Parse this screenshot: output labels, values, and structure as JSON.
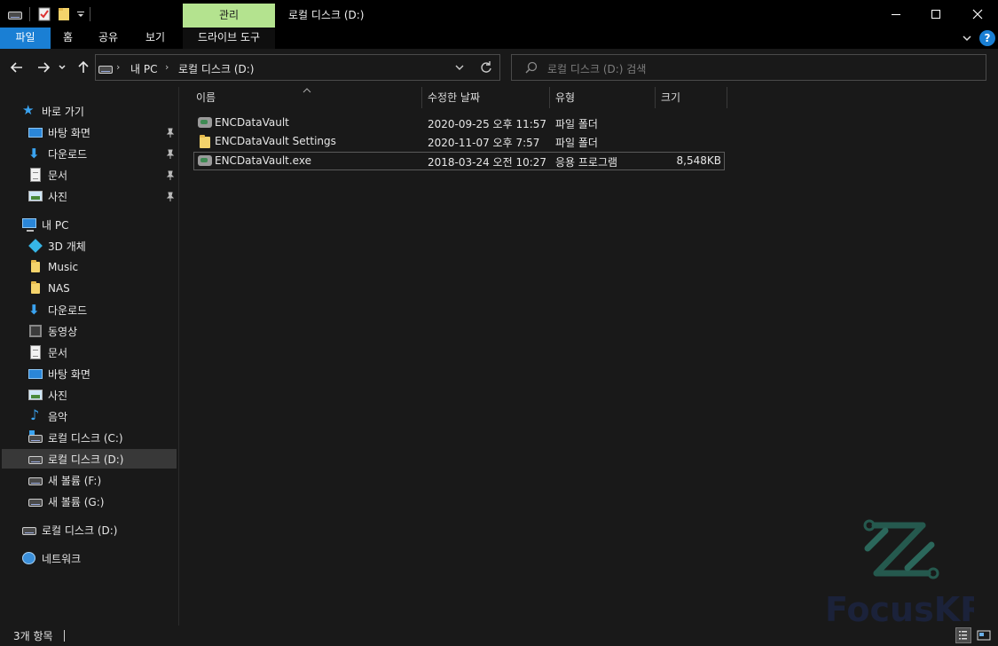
{
  "titlebar": {
    "context_tab": "관리",
    "window_title": "로컬 디스크 (D:)",
    "minimize_glyph": "—",
    "maximize_glyph": "☐",
    "close_glyph": "✕"
  },
  "ribbon": {
    "tabs": [
      "파일",
      "홈",
      "공유",
      "보기",
      "드라이브 도구"
    ],
    "expand_glyph": "⌄",
    "help_glyph": "?"
  },
  "addressbar": {
    "crumbs": [
      "내 PC",
      "로컬 디스크 (D:)"
    ],
    "search_placeholder": "로컬 디스크 (D:) 검색"
  },
  "nav": {
    "quick_access": "바로 가기",
    "quick_items": [
      "바탕 화면",
      "다운로드",
      "문서",
      "사진"
    ],
    "this_pc": "내 PC",
    "pc_items": [
      "3D 개체",
      "Music",
      "NAS",
      "다운로드",
      "동영상",
      "문서",
      "바탕 화면",
      "사진",
      "음악",
      "로컬 디스크 (C:)",
      "로컬 디스크 (D:)",
      "새 볼륨 (F:)",
      "새 볼륨 (G:)"
    ],
    "drive_root": "로컬 디스크 (D:)",
    "network": "네트워크"
  },
  "columns": {
    "name": "이름",
    "modified": "수정한 날짜",
    "type": "유형",
    "size": "크기"
  },
  "files": [
    {
      "name": "ENCDataVault",
      "modified": "2020-09-25 오후 11:57",
      "type": "파일 폴더",
      "size": "",
      "icon": "vault-folder-icon"
    },
    {
      "name": "ENCDataVault Settings",
      "modified": "2020-11-07 오후 7:57",
      "type": "파일 폴더",
      "size": "",
      "icon": "folder-icon"
    },
    {
      "name": "ENCDataVault.exe",
      "modified": "2018-03-24 오전 10:27",
      "type": "응용 프로그램",
      "size": "8,548KB",
      "icon": "exe-icon"
    }
  ],
  "status": {
    "item_count": "3개 항목"
  },
  "watermark": "FocusKR",
  "colors": {
    "accent": "#1a7fd4",
    "context_tab": "#b4e38f",
    "background": "#191919",
    "titlebar": "#000000"
  }
}
